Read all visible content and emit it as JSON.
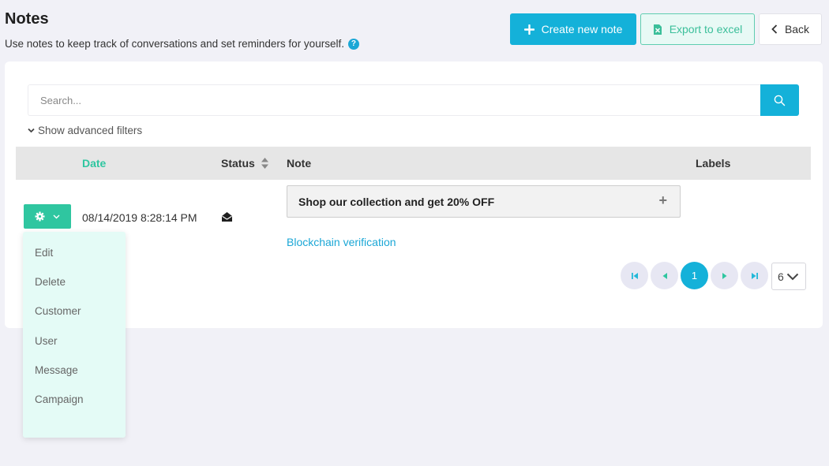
{
  "header": {
    "title": "Notes",
    "subtitle": "Use notes to keep track of conversations and set reminders for yourself.",
    "help_icon": "?"
  },
  "toolbar": {
    "create_label": "Create new note",
    "export_label": "Export to excel",
    "back_label": "Back"
  },
  "search": {
    "placeholder": "Search...",
    "advanced_filters_label": "Show advanced filters"
  },
  "table": {
    "columns": {
      "date": "Date",
      "status": "Status",
      "note": "Note",
      "labels": "Labels"
    },
    "rows": [
      {
        "date": "08/14/2019 8:28:14 PM",
        "status_icon": "envelope-open-icon",
        "note_title": "Shop our collection and get 20% OFF",
        "note_link": "Blockchain verification"
      }
    ]
  },
  "row_actions": {
    "menu": [
      "Edit",
      "Delete",
      "Customer",
      "User",
      "Message",
      "Campaign"
    ]
  },
  "pagination": {
    "current_page": "1",
    "page_size": "6"
  },
  "colors": {
    "primary": "#14b1d9",
    "accent_green": "#2fc6a0",
    "background": "#f1f1f7"
  }
}
